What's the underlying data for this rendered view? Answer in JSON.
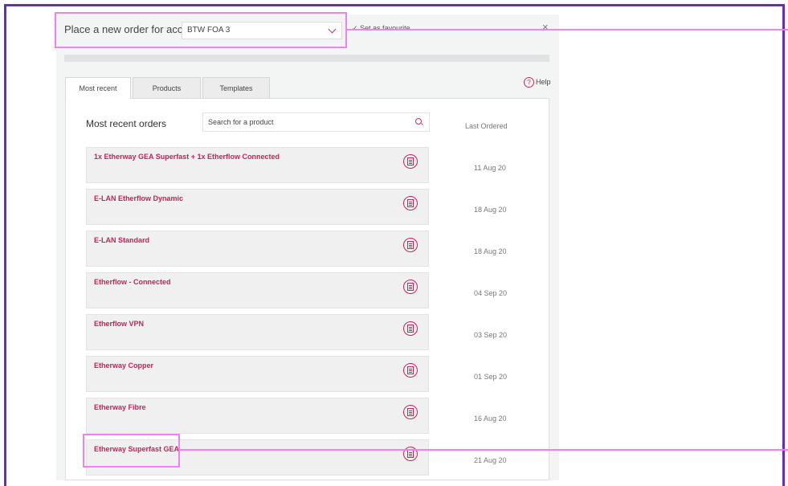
{
  "header": {
    "label": "Place a new order for account",
    "account": "BTW FOA 3",
    "favourite": "Set as favourite",
    "close": "×"
  },
  "tabs": [
    {
      "label": "Most recent",
      "active": true
    },
    {
      "label": "Products",
      "active": false
    },
    {
      "label": "Templates",
      "active": false
    }
  ],
  "help": {
    "label": "Help",
    "icon": "?"
  },
  "main": {
    "title": "Most recent orders",
    "search_placeholder": "Search for a product",
    "last_ordered_header": "Last Ordered"
  },
  "orders": [
    {
      "name": "1x Etherway GEA Superfast + 1x Etherflow Connected",
      "date": "11 Aug 20"
    },
    {
      "name": "E-LAN Etherflow Dynamic",
      "date": "18 Aug 20"
    },
    {
      "name": "E-LAN Standard",
      "date": "18 Aug 20"
    },
    {
      "name": "Etherflow - Connected",
      "date": "04 Sep 20"
    },
    {
      "name": "Etherflow VPN",
      "date": "03 Sep 20"
    },
    {
      "name": "Etherway Copper",
      "date": "01 Sep 20"
    },
    {
      "name": "Etherway Fibre",
      "date": "16 Aug 20"
    },
    {
      "name": "Etherway Superfast GEA",
      "date": "21 Aug 20"
    }
  ],
  "colors": {
    "accent": "#c2245b",
    "frame": "#6a2bb8",
    "callout": "#ee82ee"
  }
}
